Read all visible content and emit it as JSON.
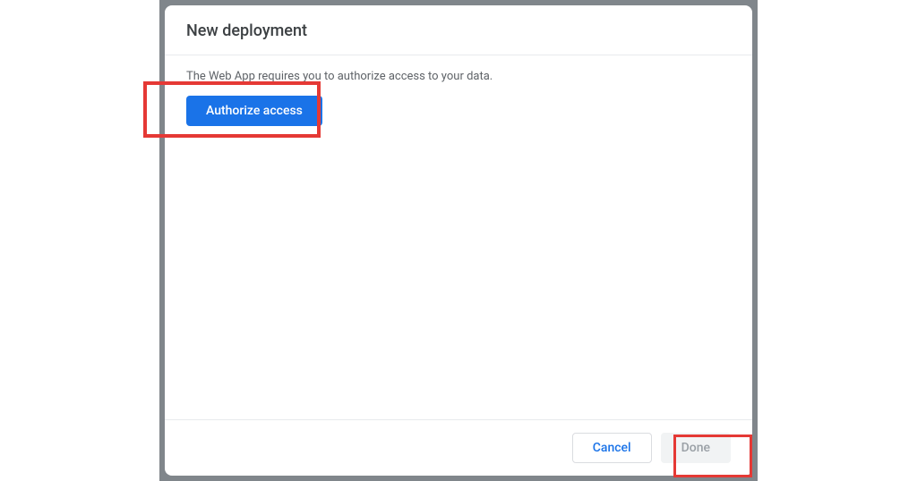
{
  "dialog": {
    "title": "New deployment",
    "auth_message": "The Web App requires you to authorize access to your data.",
    "authorize_label": "Authorize access",
    "footer": {
      "cancel_label": "Cancel",
      "done_label": "Done"
    }
  },
  "annotations": {
    "highlight_color": "#e53935"
  }
}
